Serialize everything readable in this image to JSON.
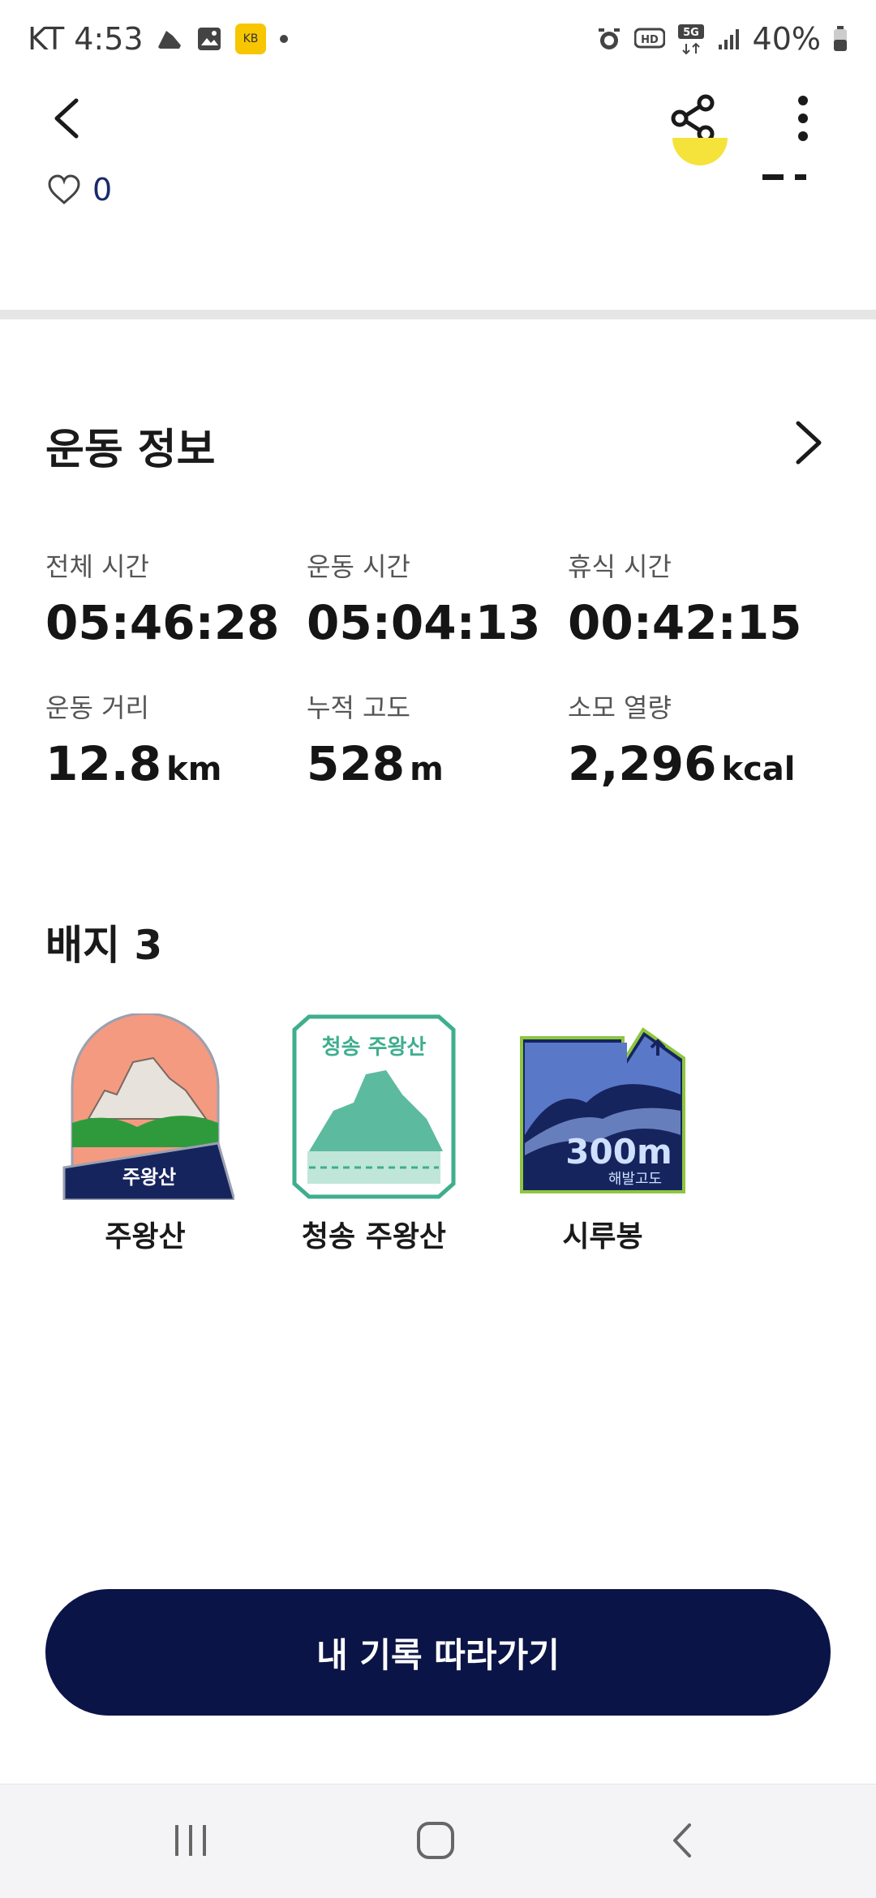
{
  "status_bar": {
    "carrier_time": "KT 4:53",
    "network": "5G",
    "battery": "40%"
  },
  "like": {
    "count": "0"
  },
  "exercise_info": {
    "title": "운동 정보",
    "stats": [
      {
        "label": "전체 시간",
        "value": "05:46:28",
        "unit": ""
      },
      {
        "label": "운동 시간",
        "value": "05:04:13",
        "unit": ""
      },
      {
        "label": "휴식 시간",
        "value": "00:42:15",
        "unit": ""
      },
      {
        "label": "운동 거리",
        "value": "12.8",
        "unit": "km"
      },
      {
        "label": "누적 고도",
        "value": "528",
        "unit": "m"
      },
      {
        "label": "소모 열량",
        "value": "2,296",
        "unit": "kcal"
      }
    ]
  },
  "badges": {
    "title": "배지 3",
    "items": [
      {
        "name": "주왕산",
        "img_text": "주왕산"
      },
      {
        "name": "청송 주왕산",
        "img_text": "청송 주왕산"
      },
      {
        "name": "시루봉",
        "img_text": "300m",
        "img_sub": "해발고도"
      }
    ]
  },
  "cta": {
    "label": "내 기록 따라가기"
  },
  "colors": {
    "primary": "#0b1446",
    "accent_yellow": "#f5e23a",
    "badge_green": "#3fae8e",
    "badge_salmon": "#f49a80"
  }
}
